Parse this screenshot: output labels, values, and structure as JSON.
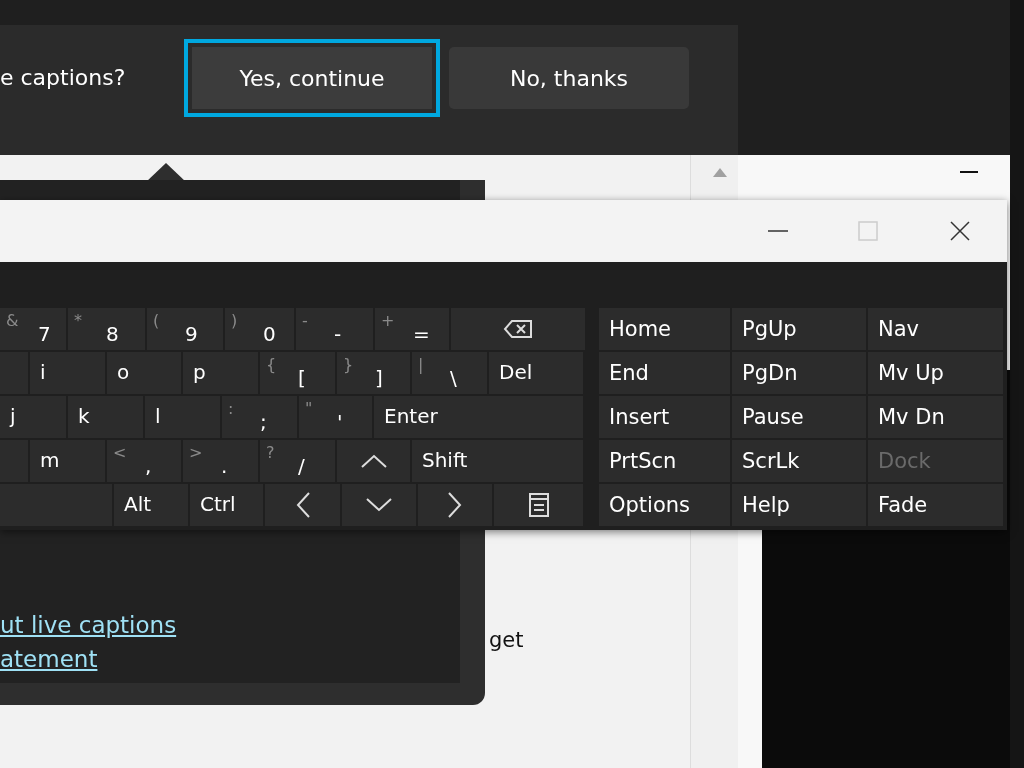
{
  "caption_prompt": {
    "question": "e captions?",
    "buttons": [
      {
        "label": "Yes, continue",
        "focused": true
      },
      {
        "label": "No, thanks",
        "focused": false
      }
    ]
  },
  "captions_flyout": {
    "links": [
      "ut live captions",
      "atement"
    ]
  },
  "page": {
    "text": "get"
  },
  "keyboard": {
    "rows": [
      [
        {
          "kind": "char",
          "shift": "&",
          "label": "7"
        },
        {
          "kind": "char",
          "shift": "*",
          "label": "8"
        },
        {
          "kind": "char",
          "shift": "(",
          "label": "9"
        },
        {
          "kind": "char",
          "shift": ")",
          "label": "0"
        },
        {
          "kind": "char",
          "shift": "-",
          "label": "-"
        },
        {
          "kind": "char",
          "shift": "+",
          "label": "="
        },
        {
          "kind": "backspace"
        }
      ],
      [
        {
          "kind": "blank"
        },
        {
          "kind": "text",
          "label": "i"
        },
        {
          "kind": "text",
          "label": "o"
        },
        {
          "kind": "text",
          "label": "p"
        },
        {
          "kind": "char",
          "shift": "{",
          "label": "["
        },
        {
          "kind": "char",
          "shift": "}",
          "label": "]"
        },
        {
          "kind": "char",
          "shift": "|",
          "label": "\\"
        },
        {
          "kind": "text",
          "label": "Del"
        }
      ],
      [
        {
          "kind": "text",
          "label": "j"
        },
        {
          "kind": "text",
          "label": "k"
        },
        {
          "kind": "text",
          "label": "l"
        },
        {
          "kind": "char",
          "shift": ":",
          "label": ";"
        },
        {
          "kind": "char",
          "shift": "\"",
          "label": "'"
        },
        {
          "kind": "text",
          "label": "Enter"
        }
      ],
      [
        {
          "kind": "blank"
        },
        {
          "kind": "text",
          "label": "m"
        },
        {
          "kind": "char",
          "shift": "<",
          "label": ","
        },
        {
          "kind": "char",
          "shift": ">",
          "label": "."
        },
        {
          "kind": "char",
          "shift": "?",
          "label": "/"
        },
        {
          "kind": "up"
        },
        {
          "kind": "text",
          "label": "Shift"
        }
      ],
      [
        {
          "kind": "blank"
        },
        {
          "kind": "text",
          "label": "Alt"
        },
        {
          "kind": "text",
          "label": "Ctrl"
        },
        {
          "kind": "left"
        },
        {
          "kind": "down"
        },
        {
          "kind": "right"
        },
        {
          "kind": "menu"
        }
      ]
    ],
    "nav_rows": [
      [
        {
          "label": "Home",
          "disabled": false
        },
        {
          "label": "PgUp",
          "disabled": false
        },
        {
          "label": "Nav",
          "disabled": false
        }
      ],
      [
        {
          "label": "End",
          "disabled": false
        },
        {
          "label": "PgDn",
          "disabled": false
        },
        {
          "label": "Mv Up",
          "disabled": false
        }
      ],
      [
        {
          "label": "Insert",
          "disabled": false
        },
        {
          "label": "Pause",
          "disabled": false
        },
        {
          "label": "Mv Dn",
          "disabled": false
        }
      ],
      [
        {
          "label": "PrtScn",
          "disabled": false
        },
        {
          "label": "ScrLk",
          "disabled": false
        },
        {
          "label": "Dock",
          "disabled": true
        }
      ],
      [
        {
          "label": "Options",
          "disabled": false
        },
        {
          "label": "Help",
          "disabled": false
        },
        {
          "label": "Fade",
          "disabled": false
        }
      ]
    ]
  }
}
